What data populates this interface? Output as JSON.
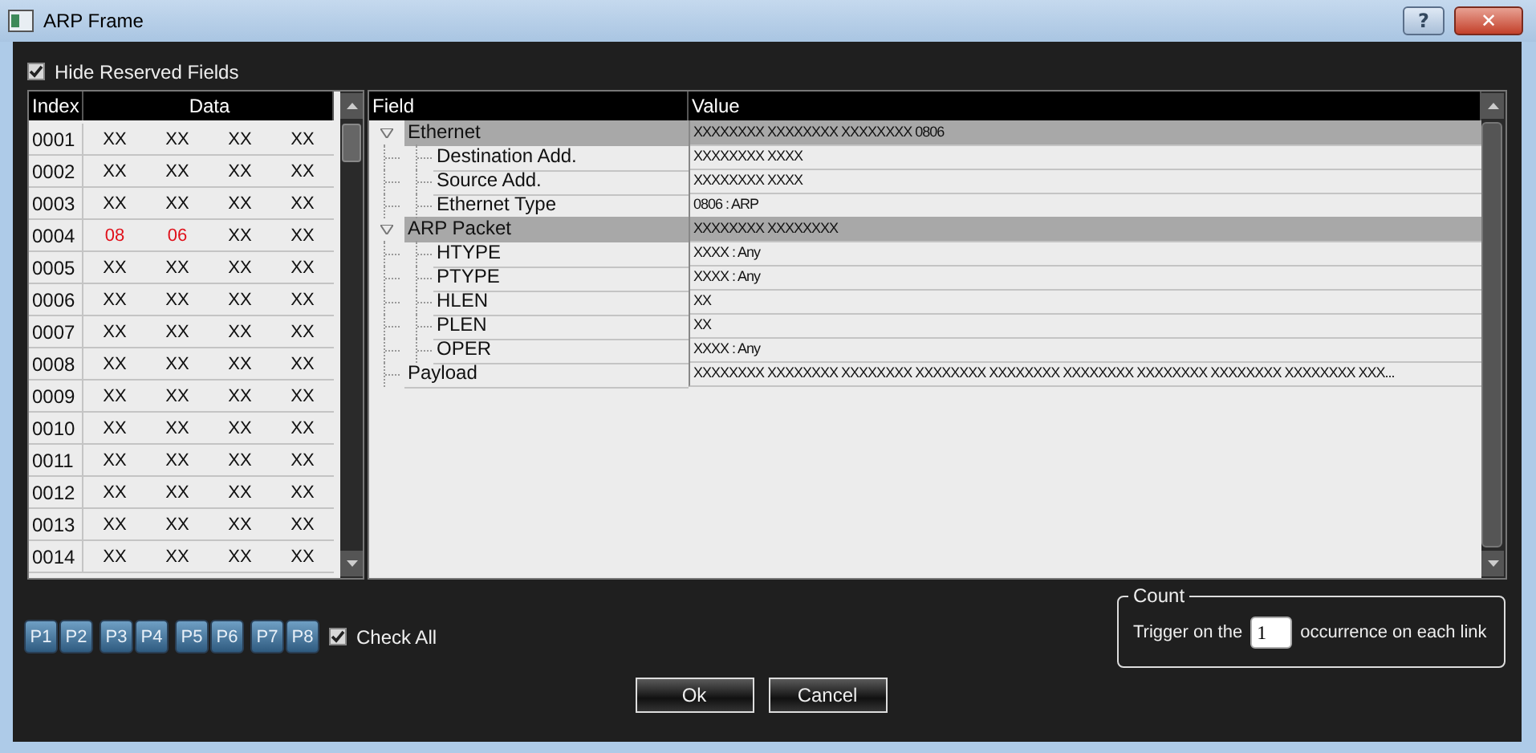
{
  "window": {
    "title": "ARP Frame",
    "buttons": [
      {
        "kind": "help",
        "label": "?"
      },
      {
        "kind": "close",
        "label": "✕"
      }
    ]
  },
  "hide_reserved_fields": {
    "label": "Hide Reserved Fields",
    "checked": true
  },
  "hex_table": {
    "columns": [
      "Index",
      "Data"
    ],
    "rows": [
      {
        "index": "0001",
        "cells": [
          {
            "text": "XX",
            "highlighted": false
          },
          {
            "text": "XX",
            "highlighted": false
          },
          {
            "text": "XX",
            "highlighted": false
          },
          {
            "text": "XX",
            "highlighted": false
          }
        ]
      },
      {
        "index": "0002",
        "cells": [
          {
            "text": "XX",
            "highlighted": false
          },
          {
            "text": "XX",
            "highlighted": false
          },
          {
            "text": "XX",
            "highlighted": false
          },
          {
            "text": "XX",
            "highlighted": false
          }
        ]
      },
      {
        "index": "0003",
        "cells": [
          {
            "text": "XX",
            "highlighted": false
          },
          {
            "text": "XX",
            "highlighted": false
          },
          {
            "text": "XX",
            "highlighted": false
          },
          {
            "text": "XX",
            "highlighted": false
          }
        ]
      },
      {
        "index": "0004",
        "cells": [
          {
            "text": "08",
            "highlighted": true
          },
          {
            "text": "06",
            "highlighted": true
          },
          {
            "text": "XX",
            "highlighted": false
          },
          {
            "text": "XX",
            "highlighted": false
          }
        ]
      },
      {
        "index": "0005",
        "cells": [
          {
            "text": "XX",
            "highlighted": false
          },
          {
            "text": "XX",
            "highlighted": false
          },
          {
            "text": "XX",
            "highlighted": false
          },
          {
            "text": "XX",
            "highlighted": false
          }
        ]
      },
      {
        "index": "0006",
        "cells": [
          {
            "text": "XX",
            "highlighted": false
          },
          {
            "text": "XX",
            "highlighted": false
          },
          {
            "text": "XX",
            "highlighted": false
          },
          {
            "text": "XX",
            "highlighted": false
          }
        ]
      },
      {
        "index": "0007",
        "cells": [
          {
            "text": "XX",
            "highlighted": false
          },
          {
            "text": "XX",
            "highlighted": false
          },
          {
            "text": "XX",
            "highlighted": false
          },
          {
            "text": "XX",
            "highlighted": false
          }
        ]
      },
      {
        "index": "0008",
        "cells": [
          {
            "text": "XX",
            "highlighted": false
          },
          {
            "text": "XX",
            "highlighted": false
          },
          {
            "text": "XX",
            "highlighted": false
          },
          {
            "text": "XX",
            "highlighted": false
          }
        ]
      },
      {
        "index": "0009",
        "cells": [
          {
            "text": "XX",
            "highlighted": false
          },
          {
            "text": "XX",
            "highlighted": false
          },
          {
            "text": "XX",
            "highlighted": false
          },
          {
            "text": "XX",
            "highlighted": false
          }
        ]
      },
      {
        "index": "0010",
        "cells": [
          {
            "text": "XX",
            "highlighted": false
          },
          {
            "text": "XX",
            "highlighted": false
          },
          {
            "text": "XX",
            "highlighted": false
          },
          {
            "text": "XX",
            "highlighted": false
          }
        ]
      },
      {
        "index": "0011",
        "cells": [
          {
            "text": "XX",
            "highlighted": false
          },
          {
            "text": "XX",
            "highlighted": false
          },
          {
            "text": "XX",
            "highlighted": false
          },
          {
            "text": "XX",
            "highlighted": false
          }
        ]
      },
      {
        "index": "0012",
        "cells": [
          {
            "text": "XX",
            "highlighted": false
          },
          {
            "text": "XX",
            "highlighted": false
          },
          {
            "text": "XX",
            "highlighted": false
          },
          {
            "text": "XX",
            "highlighted": false
          }
        ]
      },
      {
        "index": "0013",
        "cells": [
          {
            "text": "XX",
            "highlighted": false
          },
          {
            "text": "XX",
            "highlighted": false
          },
          {
            "text": "XX",
            "highlighted": false
          },
          {
            "text": "XX",
            "highlighted": false
          }
        ]
      },
      {
        "index": "0014",
        "cells": [
          {
            "text": "XX",
            "highlighted": false
          },
          {
            "text": "XX",
            "highlighted": false
          },
          {
            "text": "XX",
            "highlighted": false
          },
          {
            "text": "XX",
            "highlighted": false
          }
        ]
      }
    ]
  },
  "field_tree": {
    "columns": [
      "Field",
      "Value"
    ],
    "items": [
      {
        "field": "Ethernet",
        "value": "XXXXXXXX XXXXXXXX XXXXXXXX 0806",
        "expanded": true,
        "children": [
          {
            "field": "Destination Add.",
            "value": "XXXXXXXX XXXX"
          },
          {
            "field": "Source Add.",
            "value": "XXXXXXXX XXXX"
          },
          {
            "field": "Ethernet Type",
            "value": "0806 : ARP"
          }
        ]
      },
      {
        "field": "ARP Packet",
        "value": "XXXXXXXX XXXXXXXX",
        "expanded": true,
        "children": [
          {
            "field": "HTYPE",
            "value": "XXXX : Any"
          },
          {
            "field": "PTYPE",
            "value": "XXXX : Any"
          },
          {
            "field": "HLEN",
            "value": "XX"
          },
          {
            "field": "PLEN",
            "value": "XX"
          },
          {
            "field": "OPER",
            "value": "XXXX : Any"
          }
        ]
      },
      {
        "field": "Payload",
        "value": "XXXXXXXX XXXXXXXX XXXXXXXX XXXXXXXX XXXXXXXX XXXXXXXX XXXXXXXX XXXXXXXX XXXXXXXX XXX..."
      }
    ]
  },
  "port_groups": [
    [
      "P1",
      "P2"
    ],
    [
      "P3",
      "P4"
    ],
    [
      "P5",
      "P6"
    ],
    [
      "P7",
      "P8"
    ]
  ],
  "check_all": {
    "label": "Check All",
    "checked": true
  },
  "count": {
    "title": "Count",
    "prefix": "Trigger on the",
    "value": "1",
    "suffix": "occurrence on each link"
  },
  "buttons": [
    "Ok",
    "Cancel"
  ]
}
